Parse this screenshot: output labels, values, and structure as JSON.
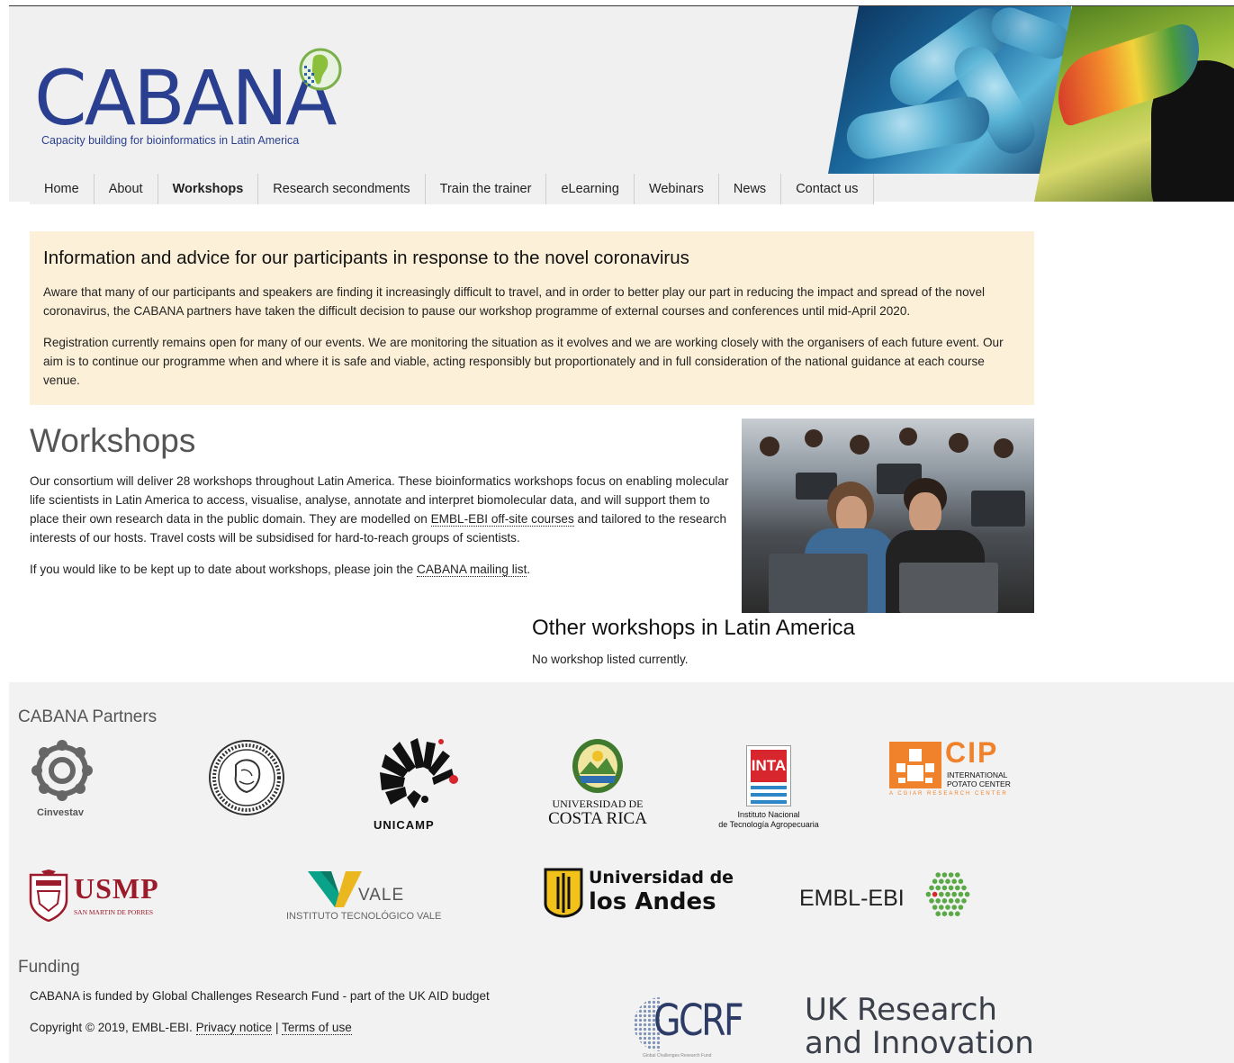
{
  "header": {
    "logo_word": "CABANA",
    "logo_tagline": "Capacity building for bioinformatics in Latin America"
  },
  "nav": {
    "items": [
      {
        "label": "Home",
        "active": false
      },
      {
        "label": "About",
        "active": false
      },
      {
        "label": "Workshops",
        "active": true
      },
      {
        "label": "Research secondments",
        "active": false
      },
      {
        "label": "Train the trainer",
        "active": false
      },
      {
        "label": "eLearning",
        "active": false
      },
      {
        "label": "Webinars",
        "active": false
      },
      {
        "label": "News",
        "active": false
      },
      {
        "label": "Contact us",
        "active": false
      }
    ]
  },
  "alert": {
    "title": "Information and advice for our participants in response to the novel coronavirus",
    "p1": "Aware that many of our participants and speakers are finding it increasingly difficult to travel, and in order to better play our part in reducing the impact and spread of the novel coronavirus, the CABANA partners have taken the difficult decision to pause our workshop programme of external courses and conferences until mid-April 2020.",
    "p2": "Registration currently remains open for many of our events. We are monitoring the situation as it evolves and we are working closely with the organisers of each future event. Our aim is to continue our programme when and where it is safe and viable, acting responsibly but proportionately and in full consideration of the national guidance at each course venue."
  },
  "workshops": {
    "title": "Workshops",
    "p1_before": "Our consortium will deliver 28 workshops throughout Latin America. These bioinformatics workshops focus on enabling molecular life scientists in Latin America to access, visualise, analyse, annotate and interpret biomolecular data, and will support them to place their own research data in the public domain. They are modelled on ",
    "p1_link": "EMBL-EBI off-site courses",
    "p1_after": " and tailored to the research interests of our hosts. Travel costs will be subsidised for hard-to-reach groups of scientists.",
    "p2_before": "If you would like to be kept up to date about workshops, please join the ",
    "p2_link": "CABANA mailing list",
    "p2_after": "."
  },
  "other": {
    "title": "Other workshops in Latin America",
    "text": "No workshop listed currently."
  },
  "footer": {
    "partners_title": "CABANA Partners",
    "partners": {
      "cinvestav": "Cinvestav",
      "unicamp": "UNICAMP",
      "ucr_line1": "UNIVERSIDAD DE",
      "ucr_line2": "COSTA RICA",
      "inta_mark": "INTA",
      "inta_line1": "Instituto Nacional",
      "inta_line2": "de Tecnología Agropecuaria",
      "cip_mark": "CIP",
      "cip_line1": "INTERNATIONAL",
      "cip_line2": "POTATO CENTER",
      "cip_line3": "A CGIAR RESEARCH CENTER",
      "usmp_mark": "USMP",
      "usmp_sub": "SAN MARTIN DE PORRES",
      "vale_mark": "VALE",
      "vale_sub": "INSTITUTO TECNOLÓGICO VALE",
      "andes_line1": "Universidad de",
      "andes_line2": "los Andes",
      "embl": "EMBL-EBI"
    },
    "funding_title": "Funding",
    "funding_text": "CABANA is funded by Global Challenges Research Fund - part of the UK AID budget",
    "copyright": "Copyright © 2019, EMBL-EBI.",
    "privacy": "Privacy notice",
    "sep": "|",
    "terms": "Terms of use",
    "gcrf": "GCRF",
    "gcrf_sub": "Global Challenges Research Fund",
    "ukri_line1": "UK Research",
    "ukri_line2": "and Innovation"
  },
  "colors": {
    "brand_blue": "#2a3f8f",
    "alert_bg": "#fdf0d8",
    "footer_bg": "#f2f2f2",
    "embl_green": "#5aa846",
    "unicamp_red": "#d8262e",
    "cip_orange": "#f0822b",
    "usmp_red": "#9b1b2a"
  }
}
